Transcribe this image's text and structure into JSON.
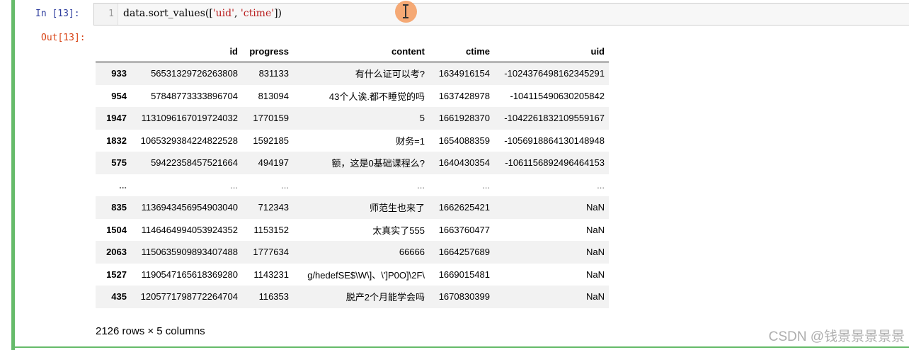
{
  "input_prompt": "In  [13]:",
  "line_number": "1",
  "code": {
    "prefix": "data.sort_values([",
    "arg1": "'uid'",
    "sep": ", ",
    "arg2": "'ctime'",
    "suffix": "])"
  },
  "output_prompt": "Out[13]:",
  "table": {
    "columns": [
      "",
      "id",
      "progress",
      "content",
      "ctime",
      "uid"
    ],
    "rows": [
      [
        "933",
        "56531329726263808",
        "831133",
        "有什么证可以考?",
        "1634916154",
        "-1024376498162345291"
      ],
      [
        "954",
        "57848773333896704",
        "813094",
        "43个人诶.都不睡觉的吗",
        "1637428978",
        "-104115490630205842"
      ],
      [
        "1947",
        "1131096167019724032",
        "1770159",
        "5",
        "1661928370",
        "-1042261832109559167"
      ],
      [
        "1832",
        "1065329384224822528",
        "1592185",
        "财务=1",
        "1654088359",
        "-1056918864130148948"
      ],
      [
        "575",
        "59422358457521664",
        "494197",
        "额，这是0基础课程么?",
        "1640430354",
        "-1061156892496464153"
      ],
      [
        "...",
        "...",
        "...",
        "...",
        "...",
        "..."
      ],
      [
        "835",
        "1136943456954903040",
        "712343",
        "师范生也来了",
        "1662625421",
        "NaN"
      ],
      [
        "1504",
        "1146464994053924352",
        "1153152",
        "太真实了555",
        "1663760477",
        "NaN"
      ],
      [
        "2063",
        "1150635909893407488",
        "1777634",
        "66666",
        "1664257689",
        "NaN"
      ],
      [
        "1527",
        "1190547165618369280",
        "1143231",
        "g/hedefSE$\\W\\]、\\']P0O]\\2F\\",
        "1669015481",
        "NaN"
      ],
      [
        "435",
        "1205771798772264704",
        "116353",
        "脱产2个月能学会吗",
        "1670830399",
        "NaN"
      ]
    ]
  },
  "summary": "2126 rows × 5 columns",
  "watermark": "CSDN @钱景景景景景",
  "colors": {
    "cell_bar": "#66bb6a",
    "in_prompt": "#303f9f",
    "out_prompt": "#d84315",
    "string": "#ba2121"
  }
}
